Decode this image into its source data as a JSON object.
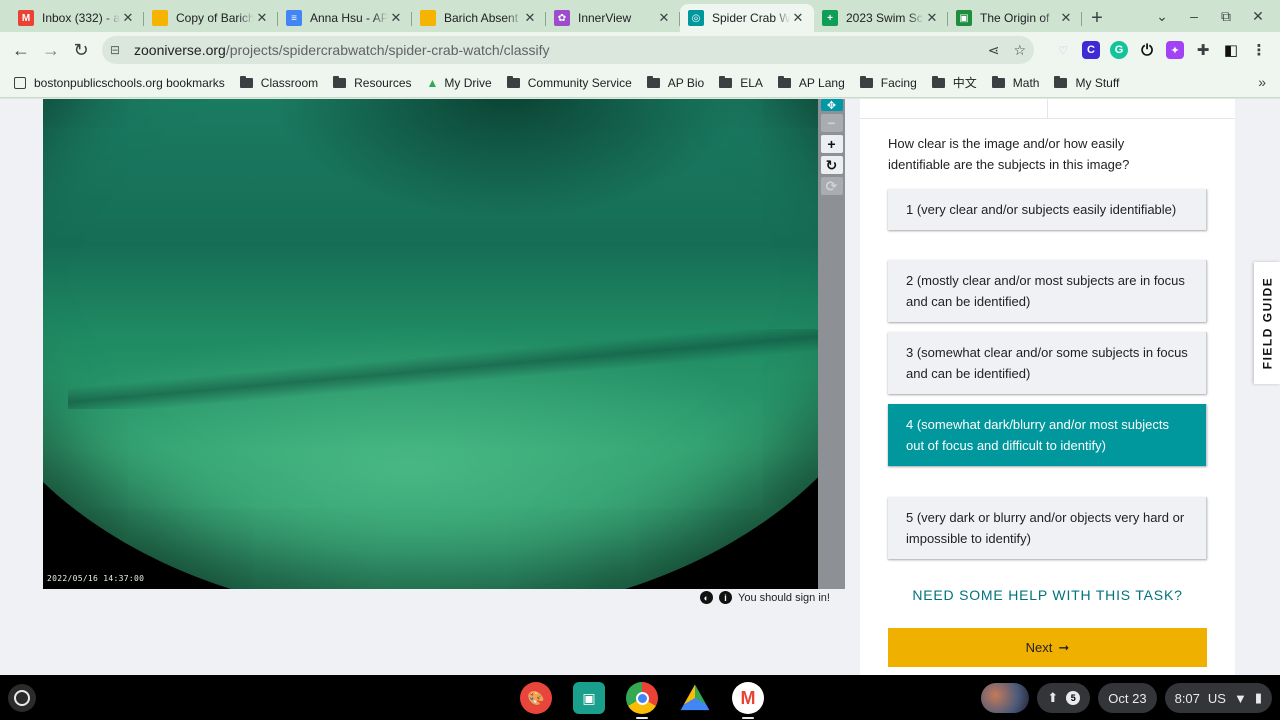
{
  "colors": {
    "accent_teal": "#00979d",
    "next_yellow": "#efb000",
    "chrome_green": "#cfe3d1"
  },
  "tabs": [
    {
      "title": "Inbox (332) - a",
      "icon": "gmail-icon",
      "color": "#ea4335",
      "glyph": "M"
    },
    {
      "title": "Copy of Barich",
      "icon": "slides-icon",
      "color": "#f4b400",
      "glyph": ""
    },
    {
      "title": "Anna Hsu - AP",
      "icon": "docs-icon",
      "color": "#4285f4",
      "glyph": "≡"
    },
    {
      "title": "Barich Absent",
      "icon": "slides-icon",
      "color": "#f4b400",
      "glyph": ""
    },
    {
      "title": "InnerView",
      "icon": "innerview-icon",
      "color": "#9c4dcc",
      "glyph": "✿"
    },
    {
      "title": "Spider Crab W",
      "icon": "zooniverse-icon",
      "color": "#00979d",
      "glyph": "◎",
      "active": true
    },
    {
      "title": "2023 Swim Sc",
      "icon": "sheets-icon",
      "color": "#0f9d58",
      "glyph": "+"
    },
    {
      "title": "The Origin of",
      "icon": "classroom-icon",
      "color": "#1e8e3e",
      "glyph": "▣"
    }
  ],
  "new_tab_label": "+",
  "url": {
    "host": "zooniverse.org",
    "path": "/projects/spidercrabwatch/spider-crab-watch/classify"
  },
  "bookmarks": [
    {
      "label": "bostonpublicschools.org bookmarks",
      "type": "page"
    },
    {
      "label": "Classroom",
      "type": "folder"
    },
    {
      "label": "Resources",
      "type": "folder"
    },
    {
      "label": "My Drive",
      "type": "drive"
    },
    {
      "label": "Community Service",
      "type": "folder"
    },
    {
      "label": "AP Bio",
      "type": "folder"
    },
    {
      "label": "ELA",
      "type": "folder"
    },
    {
      "label": "AP Lang",
      "type": "folder"
    },
    {
      "label": "Facing",
      "type": "folder"
    },
    {
      "label": "中文",
      "type": "folder"
    },
    {
      "label": "Math",
      "type": "folder"
    },
    {
      "label": "My Stuff",
      "type": "folder"
    }
  ],
  "subject": {
    "timestamp": "2022/05/16 14:37:00",
    "sign_in_text": "You should sign in!"
  },
  "task": {
    "question": "How clear is the image and/or how easily identifiable are the subjects in this image?",
    "answers": [
      {
        "label": "1 (very clear and/or subjects easily identifiable)",
        "selected": false
      },
      {
        "label": "2 (mostly clear and/or most subjects are in focus and can be identified)",
        "selected": false
      },
      {
        "label": "3 (somewhat clear and/or some subjects in focus and can be identified)",
        "selected": false
      },
      {
        "label": "4 (somewhat dark/blurry and/or most subjects out of focus and difficult to identify)",
        "selected": true
      },
      {
        "label": "5 (very dark or blurry and/or objects very hard or impossible to identify)",
        "selected": false
      }
    ],
    "help_link": "NEED SOME HELP WITH THIS TASK?",
    "next_label": "Next"
  },
  "field_guide_label": "FIELD GUIDE",
  "shelf": {
    "notification_count": "5",
    "date": "Oct 23",
    "time": "8:07",
    "locale": "US"
  }
}
